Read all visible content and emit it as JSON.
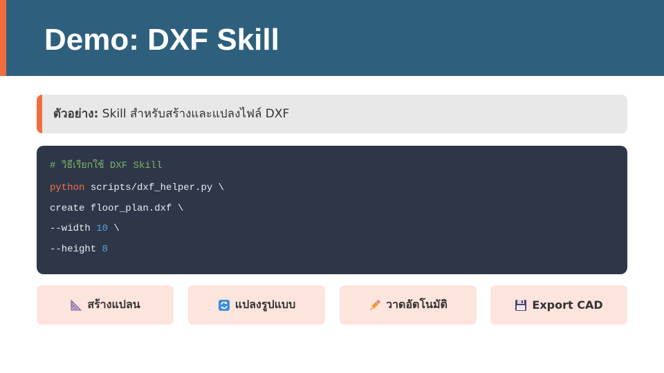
{
  "header": {
    "title": "Demo: DXF Skill",
    "accent_color": "#f26d3d",
    "background_color": "#2e607e"
  },
  "note": {
    "label": "ตัวอย่าง:",
    "text": " Skill สำหรับสร้างและแปลงไฟล์ DXF"
  },
  "code": {
    "comment": "# วิธีเรียกใช้ DXF Skill",
    "line1_keyword": "python",
    "line1_rest": " scripts/dxf_helper.py \\",
    "line2": "create floor_plan.dxf \\",
    "line3_flag": "--width ",
    "line3_num": "10",
    "line3_tail": " \\",
    "line4_flag": "--height ",
    "line4_num": "8"
  },
  "buttons": [
    {
      "icon": "triangle-ruler-icon",
      "label": "สร้างแปลน"
    },
    {
      "icon": "convert-arrows-icon",
      "label": "แปลงรูปแบบ"
    },
    {
      "icon": "pencil-icon",
      "label": "วาดอัตโนมัติ"
    },
    {
      "icon": "floppy-disk-icon",
      "label": "Export CAD"
    }
  ]
}
